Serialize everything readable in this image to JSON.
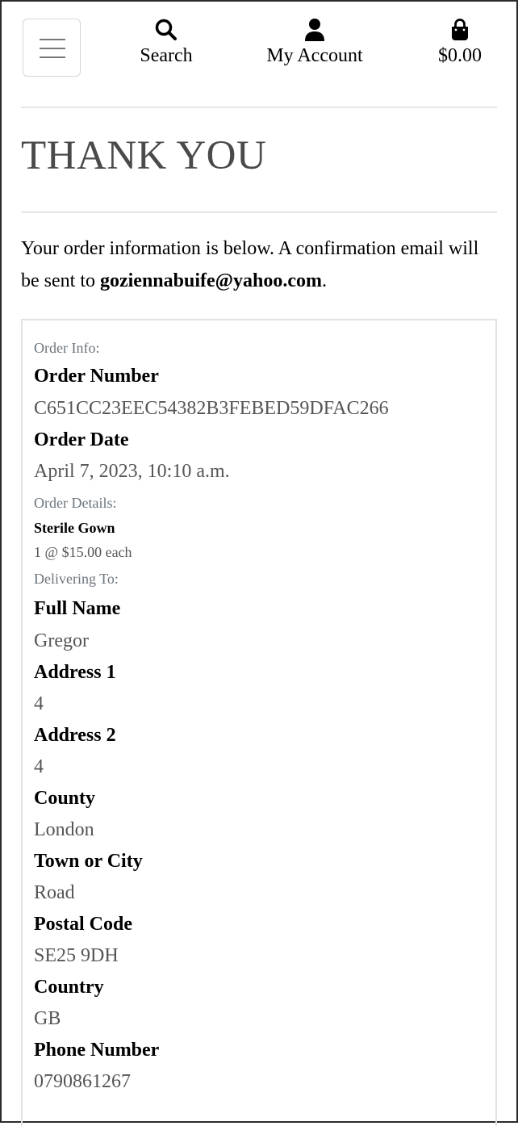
{
  "nav": {
    "search_label": "Search",
    "account_label": "My Account",
    "cart_total": "$0.00"
  },
  "page": {
    "title": "THANK YOU",
    "intro_text": "Your order information is below. A confirmation email will be sent to ",
    "email": "goziennabuife@yahoo.com",
    "intro_end": "."
  },
  "order_info": {
    "section_label": "Order Info:",
    "order_number_label": "Order Number",
    "order_number": "C651CC23EEC54382B3FEBED59DFAC266",
    "order_date_label": "Order Date",
    "order_date": "April 7, 2023, 10:10 a.m."
  },
  "order_details": {
    "section_label": "Order Details:",
    "items": [
      {
        "name": "Sterile Gown",
        "quantity_text": "1 @ $15.00 each"
      }
    ]
  },
  "delivery": {
    "section_label": "Delivering To:",
    "full_name_label": "Full Name",
    "full_name": "Gregor",
    "address1_label": "Address 1",
    "address1": "4",
    "address2_label": "Address 2",
    "address2": "4",
    "county_label": "County",
    "county": "London",
    "town_label": "Town or City",
    "town": "Road",
    "postal_label": "Postal Code",
    "postal": "SE25 9DH",
    "country_label": "Country",
    "country": "GB",
    "phone_label": "Phone Number",
    "phone": "0790861267"
  },
  "colors": {
    "title": "#4a4a4a",
    "muted": "#6c757d",
    "value": "#555555",
    "border": "#e2e2e2"
  },
  "icons": [
    "menu-icon",
    "search-icon",
    "user-icon",
    "shopping-bag-icon"
  ]
}
